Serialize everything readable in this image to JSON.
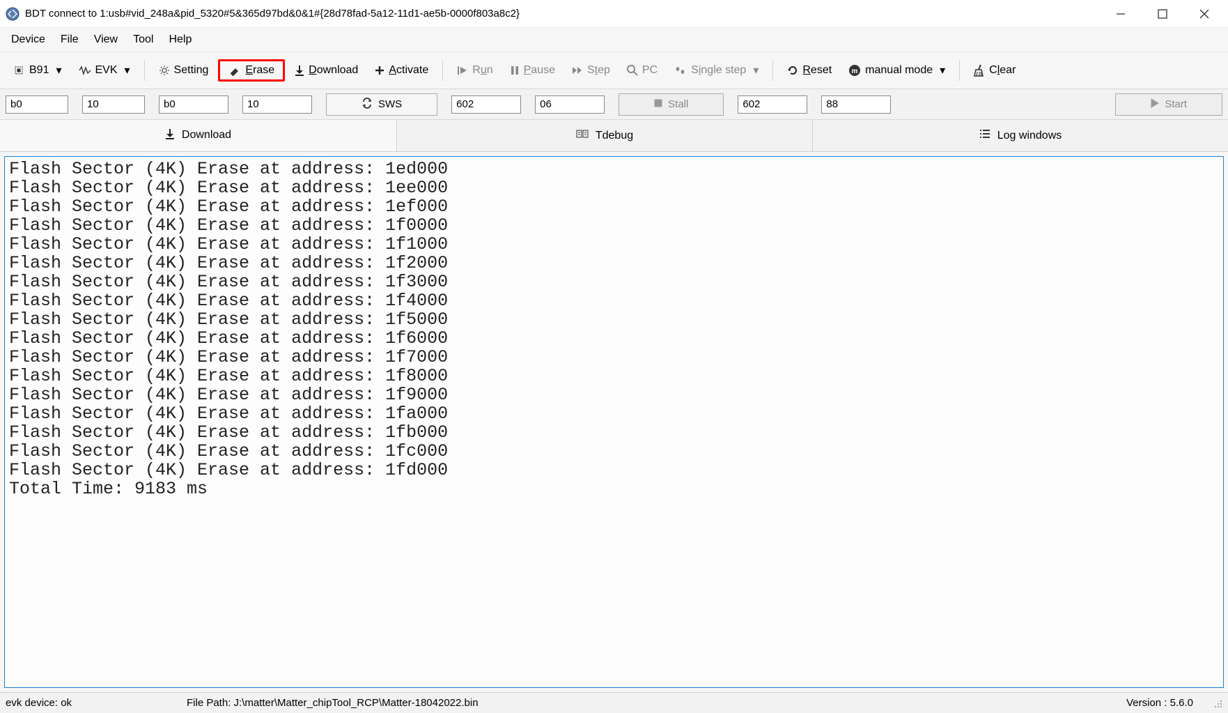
{
  "window": {
    "title": "BDT connect to 1:usb#vid_248a&pid_5320#5&365d97bd&0&1#{28d78fad-5a12-11d1-ae5b-0000f803a8c2}"
  },
  "menu": {
    "items": [
      "Device",
      "File",
      "View",
      "Tool",
      "Help"
    ]
  },
  "toolbar": {
    "chip_label": "B91",
    "board_label": "EVK",
    "setting": "Setting",
    "erase": "Erase",
    "download": "Download",
    "activate": "Activate",
    "run": "Run",
    "pause": "Pause",
    "step": "Step",
    "pc": "PC",
    "single_step": "Single step",
    "reset": "Reset",
    "manual_mode": "manual mode",
    "clear": "Clear"
  },
  "fields": {
    "a1": "b0",
    "a2": "10",
    "b1": "b0",
    "b2": "10",
    "sws_btn": "SWS",
    "c1": "602",
    "c2": "06",
    "stall_btn": "Stall",
    "d1": "602",
    "d2": "88",
    "start_btn": "Start"
  },
  "tabs": {
    "download": "Download",
    "tdebug": "Tdebug",
    "log": "Log windows"
  },
  "log_lines": [
    "Flash Sector (4K) Erase at address: 1ed000",
    "Flash Sector (4K) Erase at address: 1ee000",
    "Flash Sector (4K) Erase at address: 1ef000",
    "Flash Sector (4K) Erase at address: 1f0000",
    "Flash Sector (4K) Erase at address: 1f1000",
    "Flash Sector (4K) Erase at address: 1f2000",
    "Flash Sector (4K) Erase at address: 1f3000",
    "Flash Sector (4K) Erase at address: 1f4000",
    "Flash Sector (4K) Erase at address: 1f5000",
    "Flash Sector (4K) Erase at address: 1f6000",
    "Flash Sector (4K) Erase at address: 1f7000",
    "Flash Sector (4K) Erase at address: 1f8000",
    "Flash Sector (4K) Erase at address: 1f9000",
    "Flash Sector (4K) Erase at address: 1fa000",
    "Flash Sector (4K) Erase at address: 1fb000",
    "Flash Sector (4K) Erase at address: 1fc000",
    "Flash Sector (4K) Erase at address: 1fd000",
    "Total Time: 9183 ms"
  ],
  "status": {
    "device": "evk device: ok",
    "filepath": "File Path:  J:\\matter\\Matter_chipTool_RCP\\Matter-18042022.bin",
    "version": "Version : 5.6.0"
  }
}
